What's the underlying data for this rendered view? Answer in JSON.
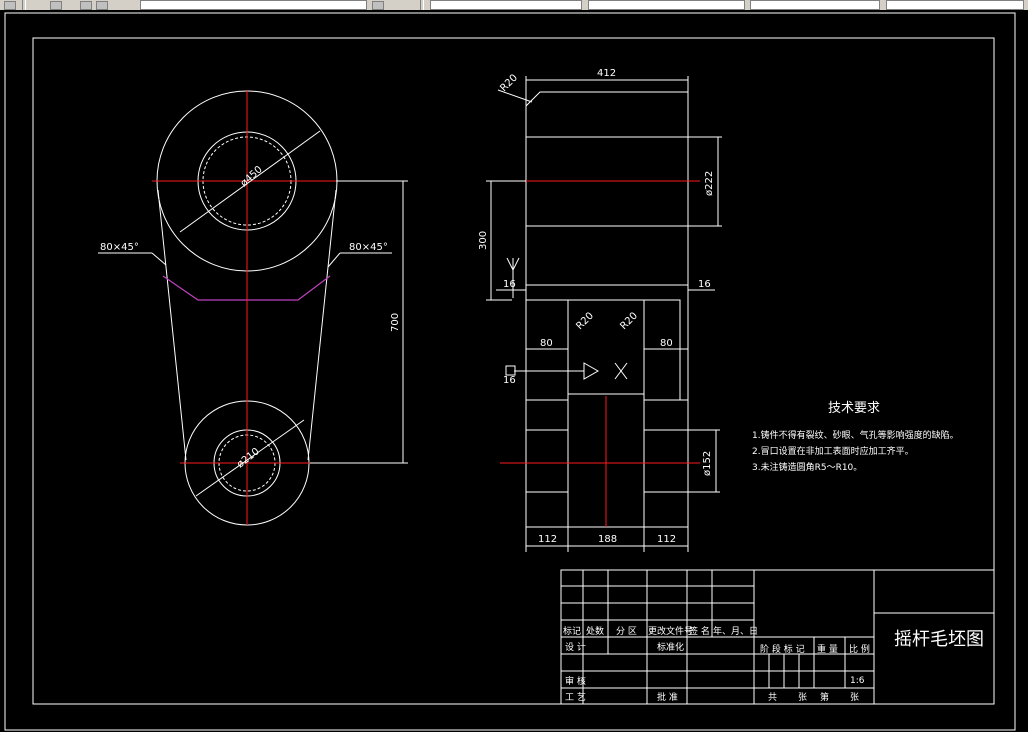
{
  "toolbar": {
    "icons": [
      "file-icon",
      "layer-icon",
      "color-icon",
      "linetype-icon",
      "undo-icon"
    ],
    "fields": [
      "layer-dropdown",
      "color-dropdown",
      "linetype-dropdown",
      "lineweight-dropdown",
      "plotstyle-dropdown"
    ]
  },
  "front_view": {
    "chamfer_left": "80×45°",
    "chamfer_right": "80×45°",
    "top_bore": "ø450",
    "bottom_bore": "ø210",
    "center_distance": "700"
  },
  "section_view": {
    "width_top": "412",
    "radius_top": "R20",
    "bore_top": "ø222",
    "height_300": "300",
    "offset_left": "16",
    "offset_right": "16",
    "radius_inner_1": "R20",
    "radius_inner_2": "R20",
    "web_left": "80",
    "web_right": "80",
    "left_step": "16",
    "bore_bottom": "ø152",
    "bottom_left": "112",
    "bottom_mid": "188",
    "bottom_right": "112"
  },
  "tech_req": {
    "title": "技术要求",
    "items": [
      "1.铸件不得有裂纹、砂眼、气孔等影响强度的缺陷。",
      "2.冒口设置在非加工表面时应加工齐平。",
      "3.未注铸造圆角R5～R10。"
    ]
  },
  "title_block": {
    "row_labels": [
      "标记",
      "处数",
      "分 区",
      "更改文件号",
      "签 名",
      "年、月、日"
    ],
    "design": "设 计",
    "standardize": "标准化",
    "review": "审 核",
    "process": "工 艺",
    "approve": "批 准",
    "stage_mark": "阶 段 标 记",
    "weight": "重 量",
    "scale": "比 例",
    "scale_value": "1:6",
    "sheets_total": "共",
    "sheets_unit": "张",
    "sheet_no": "第",
    "sheet_unit2": "张",
    "drawing_name": "摇杆毛坯图"
  }
}
